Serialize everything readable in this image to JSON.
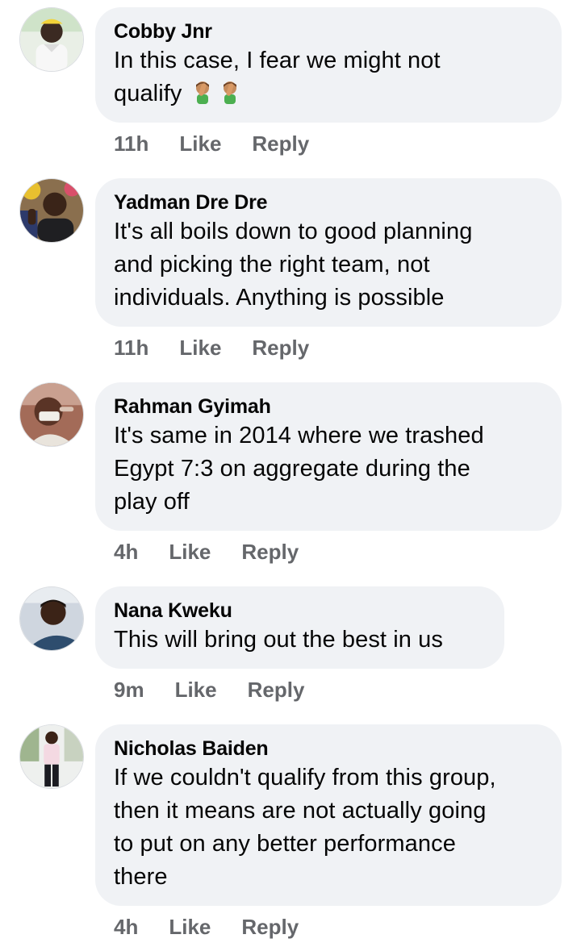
{
  "actions": {
    "like_label": "Like",
    "reply_label": "Reply"
  },
  "comments": [
    {
      "author": "Cobby Jnr",
      "lines": [
        "In this case, I fear we might not",
        "qualify"
      ],
      "emoji": [
        "man-facepalming-emoji",
        "man-facepalming-emoji"
      ],
      "time": "11h"
    },
    {
      "author": "Yadman Dre Dre",
      "lines": [
        "It's all boils down to good planning",
        "and picking the right team, not",
        "individuals. Anything is possible"
      ],
      "time": "11h"
    },
    {
      "author": "Rahman Gyimah",
      "lines": [
        "It's same in 2014 where we trashed",
        "Egypt 7:3 on aggregate during the",
        "play off"
      ],
      "time": "4h"
    },
    {
      "author": "Nana Kweku",
      "lines": [
        "This will bring out the best in us"
      ],
      "time": "9m"
    },
    {
      "author": "Nicholas Baiden",
      "lines": [
        "If we couldn't qualify from this group,",
        "then it means are not actually going",
        "to put on any better performance",
        "there"
      ],
      "time": "4h"
    }
  ],
  "colors": {
    "bubble": "#f0f2f5",
    "meta_text": "#65676b",
    "body_text": "#050505"
  }
}
